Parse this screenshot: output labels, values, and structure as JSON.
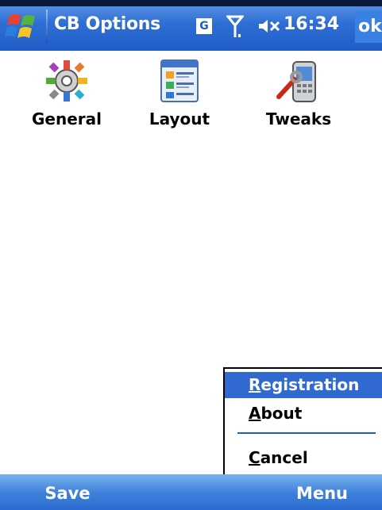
{
  "titlebar": {
    "title": "CB Options",
    "network_indicator": "G",
    "time": "16:34",
    "ok_label": "ok",
    "icons": [
      "windows-start-icon",
      "network-g-icon",
      "signal-antenna-icon",
      "volume-muted-icon"
    ]
  },
  "grid": [
    {
      "label": "General",
      "icon": "general-settings-icon"
    },
    {
      "label": "Layout",
      "icon": "layout-icon"
    },
    {
      "label": "Tweaks",
      "icon": "tweaks-icon"
    }
  ],
  "menu": {
    "items": [
      {
        "label": "Registration",
        "hotkey": "R",
        "rest": "egistration",
        "selected": true
      },
      {
        "label": "About",
        "hotkey": "A",
        "rest": "bout",
        "selected": false
      },
      {
        "label": "Cancel",
        "hotkey": "C",
        "rest": "ancel",
        "selected": false
      }
    ]
  },
  "softkeys": {
    "left": "Save",
    "right": "Menu"
  },
  "colors": {
    "titlebar": "#2f6fd4",
    "selection": "#3069cf",
    "softkey_bar": "#3f82dc"
  }
}
